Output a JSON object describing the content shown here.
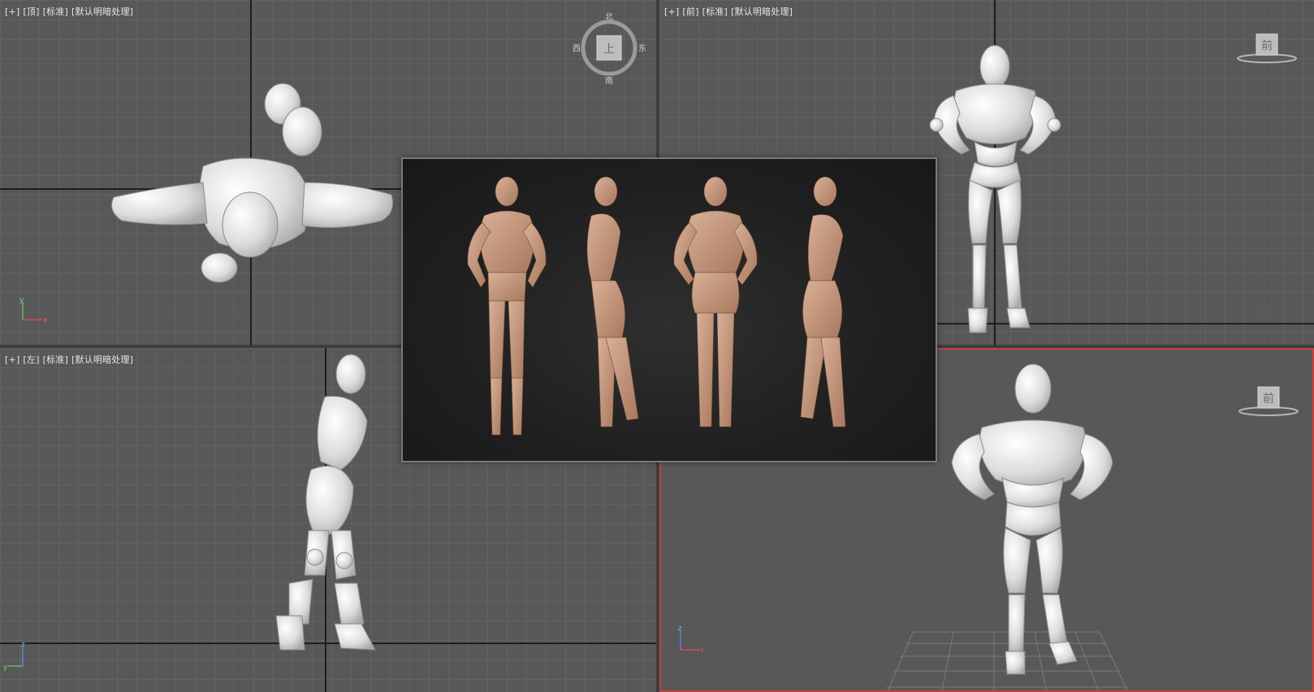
{
  "viewports": {
    "top_left": {
      "labels": [
        "[+]",
        "[顶]",
        "[标准]",
        "[默认明暗处理]"
      ],
      "viewcube_face": "上",
      "compass": {
        "n": "北",
        "s": "南",
        "e": "东",
        "w": "西"
      }
    },
    "top_right": {
      "labels": [
        "[+]",
        "[前]",
        "[标准]",
        "[默认明暗处理]"
      ],
      "viewcube_face": "前"
    },
    "bottom_left": {
      "labels": [
        "[+]",
        "[左]",
        "[标准]",
        "[默认明暗处理]"
      ]
    },
    "bottom_right": {
      "viewcube_face": "前",
      "active": true
    }
  },
  "gizmo_axes": {
    "x": "x",
    "y": "y",
    "z": "z"
  },
  "colors": {
    "active_border": "#c8403b",
    "viewport_bg": "#585858",
    "grid_line": "#626262",
    "axis_line": "#1e1e1e",
    "model": "#e8e8e8",
    "skin": "#c79a7f"
  }
}
